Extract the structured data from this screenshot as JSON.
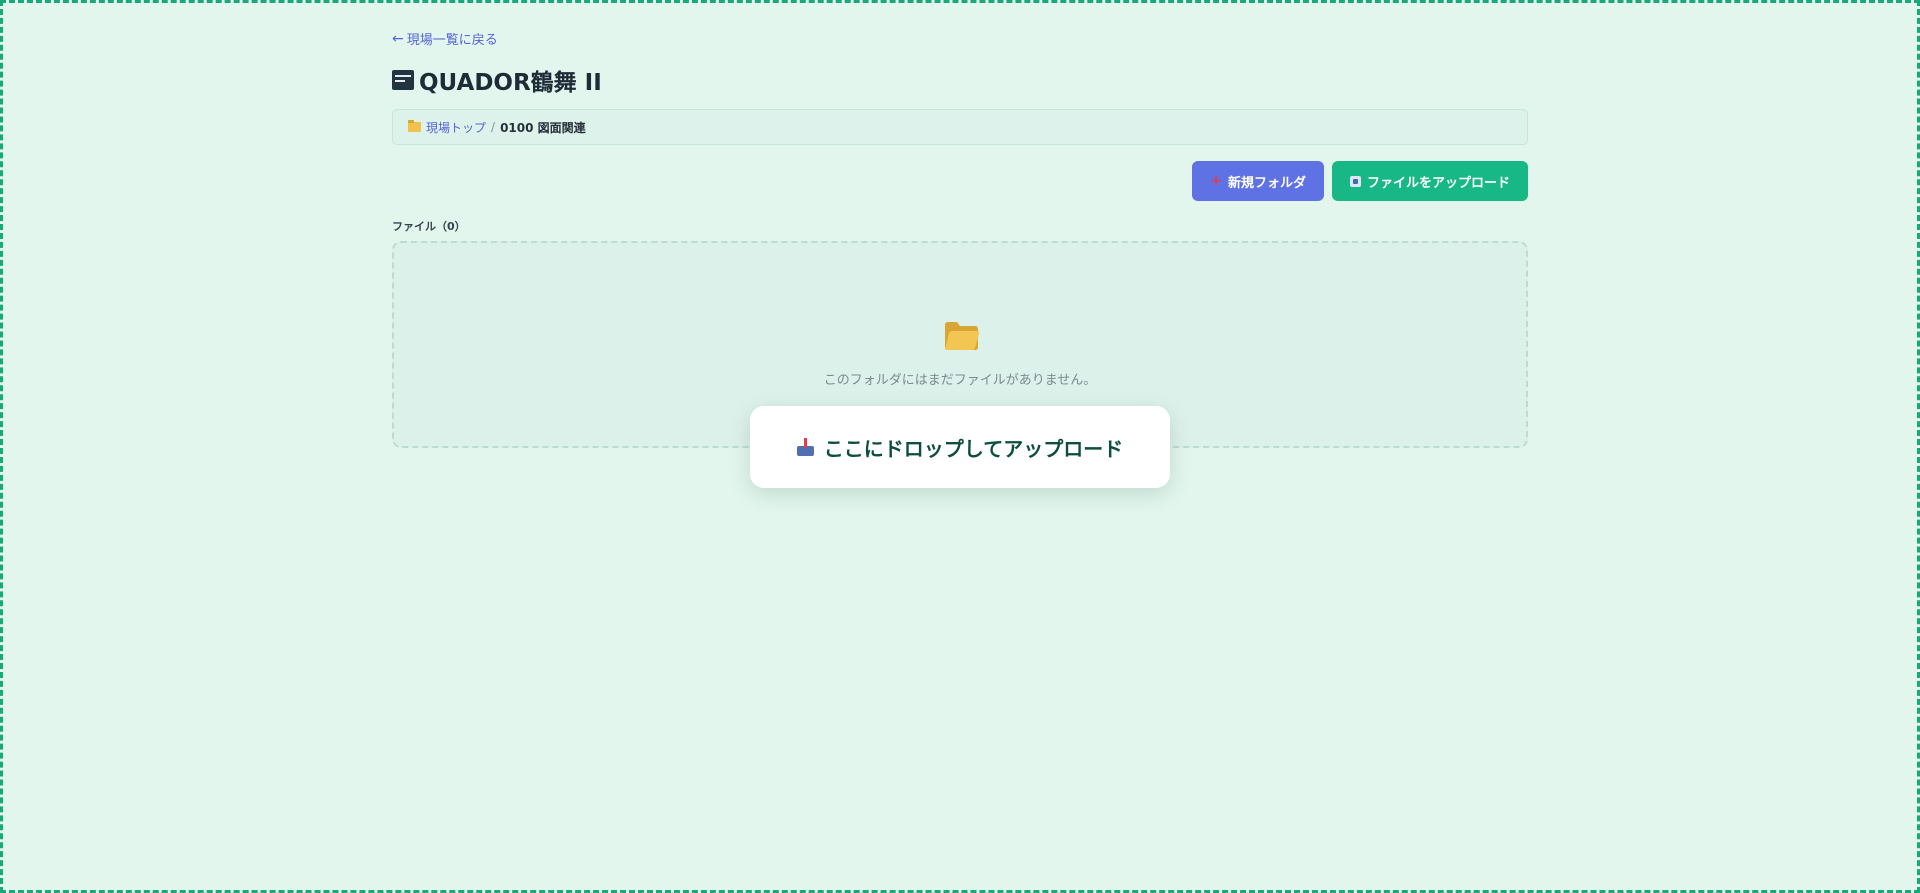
{
  "nav": {
    "back_arrow": "←",
    "back_label": "現場一覧に戻る"
  },
  "header": {
    "title": "QUADOR鶴舞 II",
    "title_icon": "cash-register-icon"
  },
  "breadcrumb": {
    "icon": "folder-icon",
    "root_label": "現場トップ",
    "separator": "/",
    "current_label": "0100 図面関連"
  },
  "toolbar": {
    "new_folder_icon": "+",
    "new_folder_label": "新規フォルダ",
    "upload_icon": "upload-icon",
    "upload_label": "ファイルをアップロード"
  },
  "files": {
    "heading": "ファイル（0）",
    "empty_icon": "open-folder-icon",
    "empty_message": "このフォルダにはまだファイルがありません。"
  },
  "drop_overlay": {
    "icon": "inbox-tray-icon",
    "label": "ここにドロップしてアップロード"
  },
  "colors": {
    "background": "#e2f6ee",
    "drop_border": "#16a97a",
    "link": "#5463d6",
    "primary_button": "#5f72e3",
    "upload_button": "#17b886",
    "overlay_text": "#0d4e3c"
  }
}
